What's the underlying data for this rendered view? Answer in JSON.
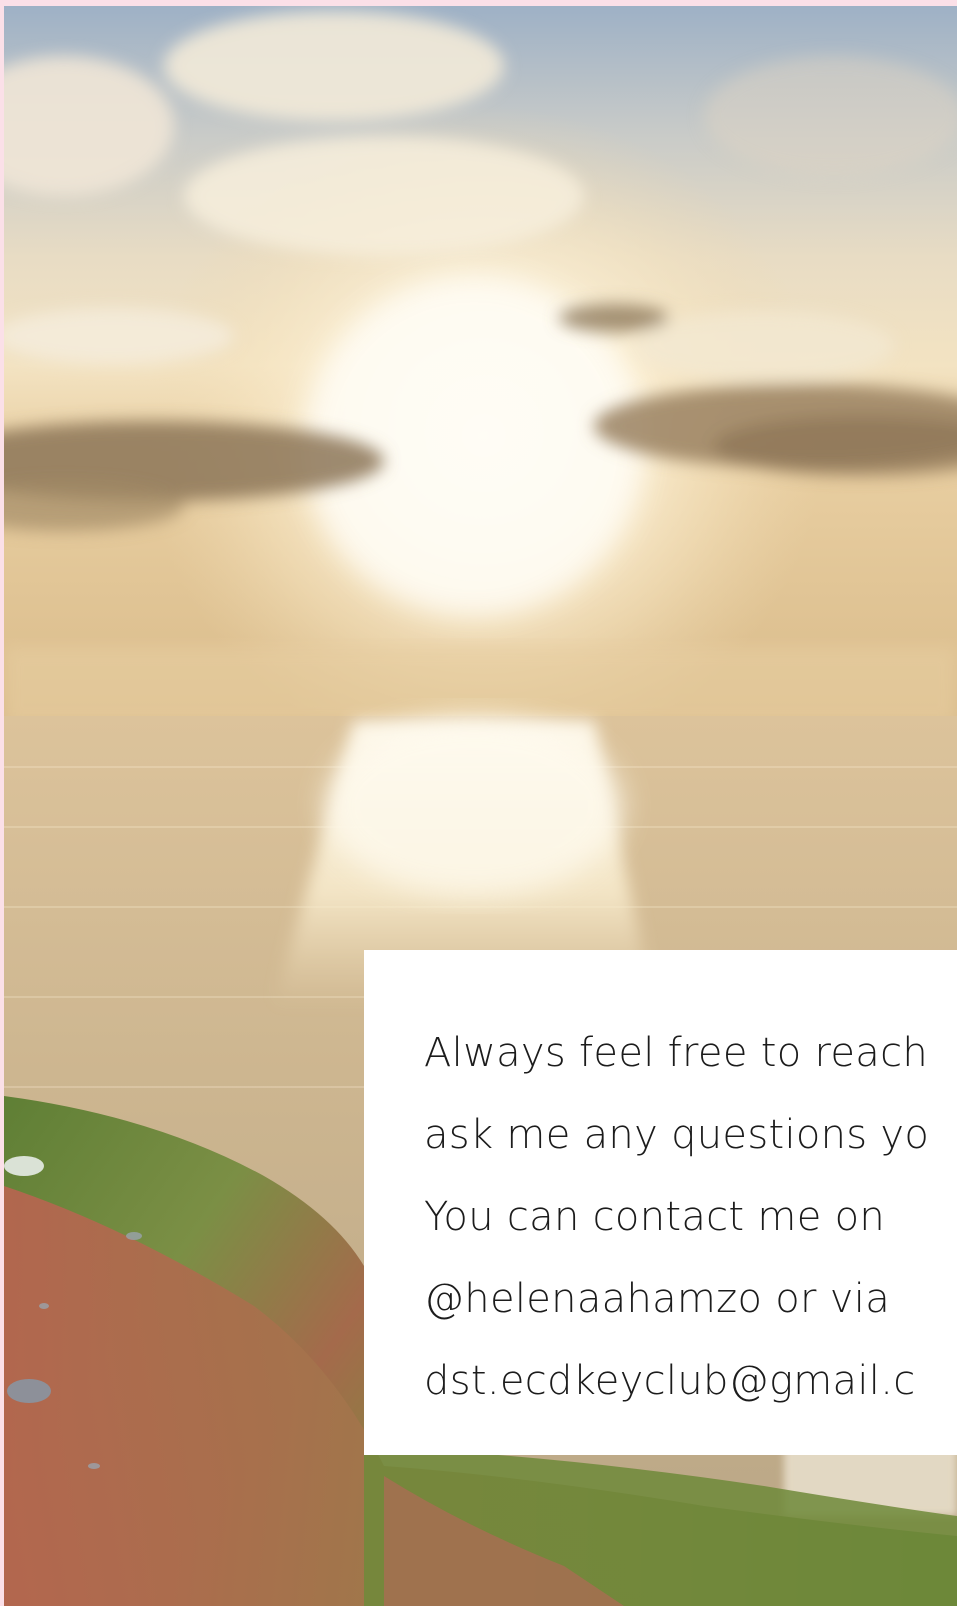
{
  "hero": {
    "image": "sunset-over-sea-with-grassy-hillside",
    "palette": {
      "sky_blue": "#8fa6c0",
      "sun_glow": "#fffaea",
      "sea": "#c9b08a",
      "hill_green": "#6b8a3c",
      "hill_red": "#b4634f"
    }
  },
  "contact": {
    "lines": [
      "Always feel free to reach",
      "ask me any questions yo",
      "You can contact me on",
      "@helenaahamzo or via",
      "dst.ecdkeyclub@gmail.c"
    ]
  },
  "colors": {
    "page_border": "#fbe0e8",
    "card_background": "#ffffff",
    "text": "#1c1c1c"
  }
}
